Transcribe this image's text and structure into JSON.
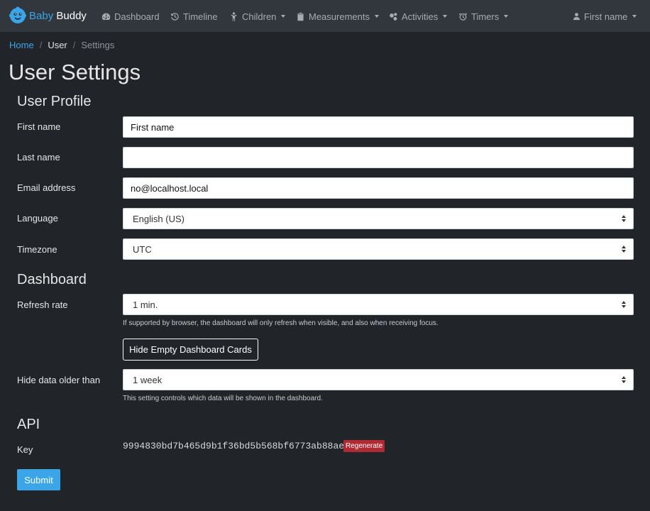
{
  "brand": {
    "name_part1": "Baby",
    "name_part2": "Buddy"
  },
  "nav": {
    "items": [
      {
        "label": "Dashboard",
        "icon": "dashboard-icon",
        "dropdown": false
      },
      {
        "label": "Timeline",
        "icon": "timeline-icon",
        "dropdown": false
      },
      {
        "label": "Children",
        "icon": "child-icon",
        "dropdown": true
      },
      {
        "label": "Measurements",
        "icon": "clipboard-icon",
        "dropdown": true
      },
      {
        "label": "Activities",
        "icon": "activities-icon",
        "dropdown": true
      },
      {
        "label": "Timers",
        "icon": "timer-icon",
        "dropdown": true
      }
    ],
    "user": {
      "label": "First name",
      "icon": "user-icon"
    }
  },
  "breadcrumb": {
    "home": "Home",
    "user": "User",
    "current": "Settings"
  },
  "page_title": "User Settings",
  "profile": {
    "title": "User Profile",
    "first_name": {
      "label": "First name",
      "value": "First name"
    },
    "last_name": {
      "label": "Last name",
      "value": ""
    },
    "email": {
      "label": "Email address",
      "value": "no@localhost.local"
    },
    "language": {
      "label": "Language",
      "value": "English (US)"
    },
    "timezone": {
      "label": "Timezone",
      "value": "UTC"
    }
  },
  "dashboard": {
    "title": "Dashboard",
    "refresh_rate": {
      "label": "Refresh rate",
      "value": "1 min.",
      "help": "If supported by browser, the dashboard will only refresh when visible, and also when receiving focus."
    },
    "hide_empty_button": "Hide Empty Dashboard Cards",
    "hide_older": {
      "label": "Hide data older than",
      "value": "1 week",
      "help": "This setting controls which data will be shown in the dashboard."
    }
  },
  "api": {
    "title": "API",
    "key_label": "Key",
    "key_value": "9994830bd7b465d9b1f36bd5b568bf6773ab88ae",
    "regenerate_label": "Regenerate"
  },
  "submit_label": "Submit",
  "colors": {
    "accent": "#3aa6e8",
    "danger": "#b12a33",
    "navbar": "#32363d",
    "background": "#212429"
  }
}
